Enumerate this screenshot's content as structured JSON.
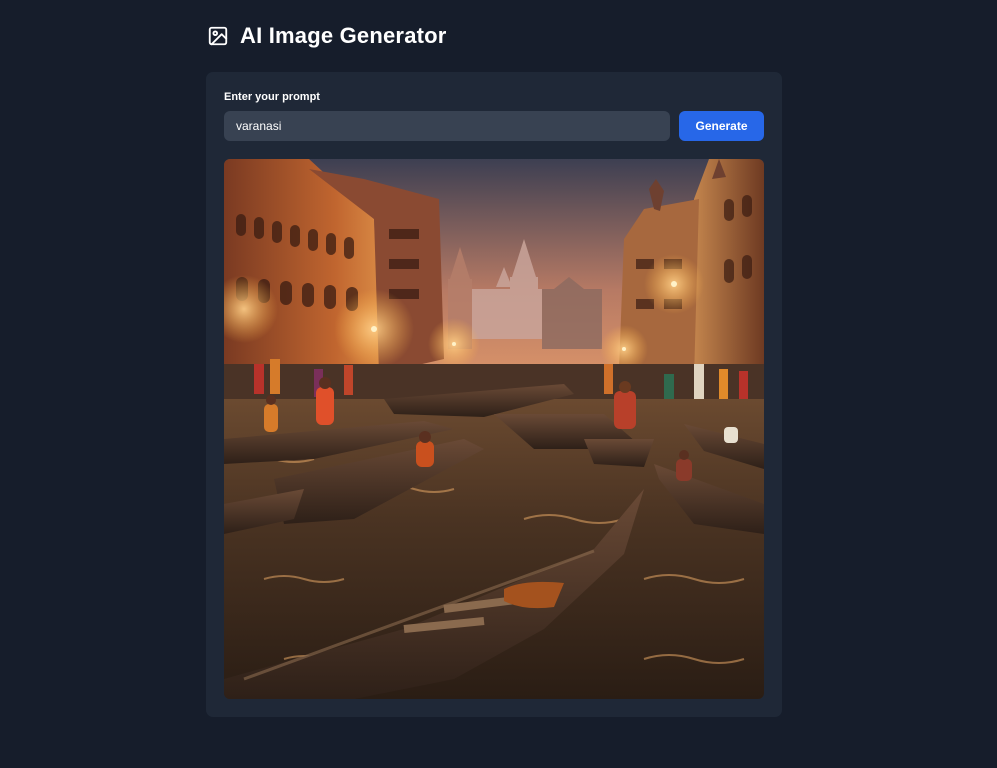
{
  "header": {
    "title": "AI Image Generator",
    "icon": "image-icon"
  },
  "form": {
    "label": "Enter your prompt",
    "prompt_value": "varanasi",
    "generate_label": "Generate"
  },
  "result": {
    "image_subject": "varanasi",
    "colors": {
      "sky_top": "#3d3f52",
      "sky_glow": "#e39a6a",
      "water": "#3a2a1c",
      "lamp": "#ffb347"
    }
  },
  "colors": {
    "background": "#161d2b",
    "card": "#1f2837",
    "input": "#384252",
    "accent": "#2767e8"
  }
}
